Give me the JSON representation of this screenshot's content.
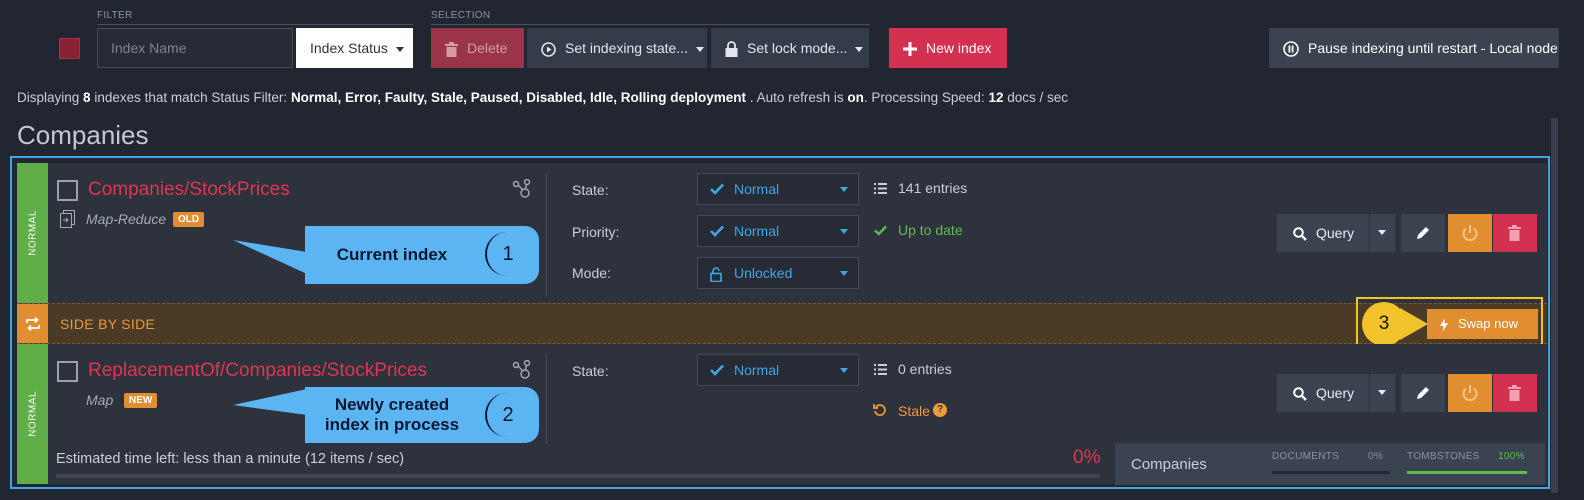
{
  "toolbar": {
    "filter_label": "FILTER",
    "selection_label": "SELECTION",
    "index_name_placeholder": "Index Name",
    "index_status_label": "Index Status",
    "delete_label": "Delete",
    "set_indexing_state_label": "Set indexing state...",
    "set_lock_mode_label": "Set lock mode...",
    "new_index_label": "New index",
    "pause_label": "Pause indexing until restart - Local node"
  },
  "info": {
    "prefix": "Displaying",
    "count": "8",
    "mid": "indexes that match Status Filter:",
    "filters": "Normal, Error, Faulty, Stale, Paused, Disabled, Idle, Rolling deployment",
    "auto_refresh_prefix": ". Auto refresh is",
    "auto_refresh_value": "on",
    "speed_prefix": ". Processing Speed:",
    "speed_value": "12",
    "speed_unit": "docs / sec"
  },
  "group": {
    "title": "Companies"
  },
  "index1": {
    "side_label": "NORMAL",
    "name": "Companies/StockPrices",
    "type": "Map-Reduce",
    "badge": "OLD",
    "state_label": "State:",
    "state_value": "Normal",
    "priority_label": "Priority:",
    "priority_value": "Normal",
    "mode_label": "Mode:",
    "mode_value": "Unlocked",
    "entries": "141 entries",
    "status": "Up to date",
    "query_label": "Query"
  },
  "side_by_side": {
    "label": "SIDE BY SIDE",
    "swap_label": "Swap now"
  },
  "index2": {
    "side_label": "NORMAL",
    "name": "ReplacementOf/Companies/StockPrices",
    "type": "Map",
    "badge": "NEW",
    "state_label": "State:",
    "state_value": "Normal",
    "entries": "0 entries",
    "status": "Stale",
    "query_label": "Query",
    "estimated": "Estimated time left: less than a minute (12 items / sec)",
    "percent": "0%",
    "stats": {
      "collection": "Companies",
      "documents_label": "DOCUMENTS",
      "documents_pct": "0%",
      "documents_progress": 0,
      "tombstones_label": "TOMBSTONES",
      "tombstones_pct": "100%",
      "tombstones_progress": 1
    }
  },
  "callouts": {
    "c1_text": "Current index",
    "c1_num": "1",
    "c2_text_line1": "Newly created",
    "c2_text_line2": "index in process",
    "c2_num": "2",
    "c3_num": "3"
  },
  "colors": {
    "accent_red": "#d4304f",
    "accent_blue": "#3fa6e4",
    "accent_orange": "#e08e2f",
    "status_green": "#5cbd4f",
    "callout_blue": "#5ab5f2",
    "highlight_yellow": "#f2c32b"
  },
  "icons": {
    "trash": "trash-icon",
    "play": "play-circle-icon",
    "lock": "lock-icon",
    "plus": "plus-icon",
    "pause": "pause-circle-icon",
    "check": "check-icon",
    "list": "list-icon",
    "search": "search-icon",
    "edit": "pencil-icon",
    "power": "power-icon",
    "swap": "swap-icon",
    "bolt": "bolt-icon",
    "refresh": "refresh-icon",
    "help": "help-icon",
    "graph": "graph-icon",
    "map_reduce": "map-reduce-icon"
  }
}
